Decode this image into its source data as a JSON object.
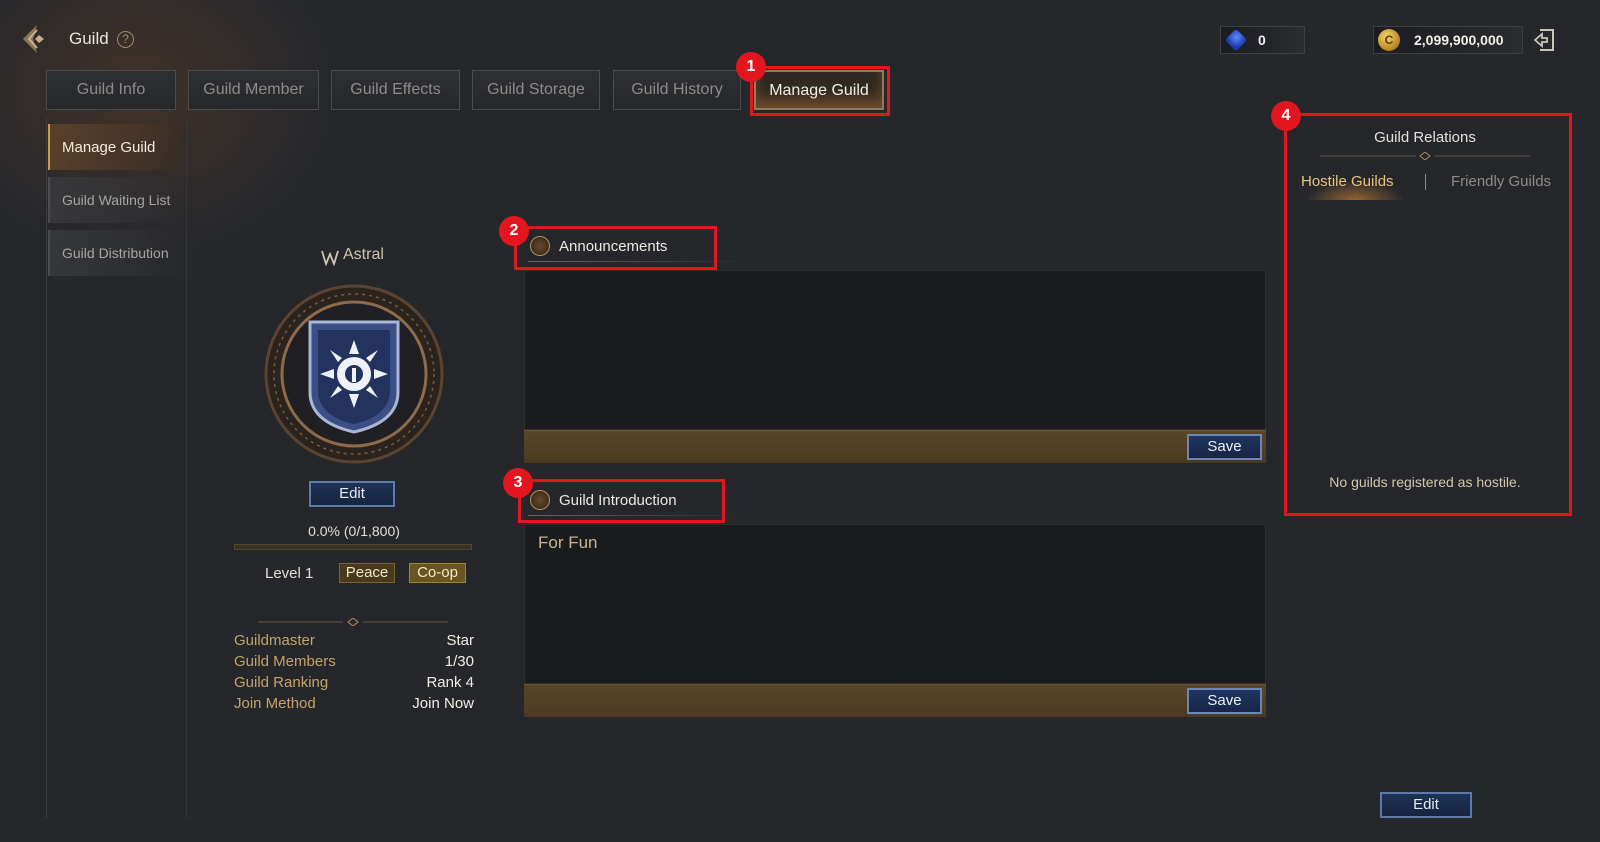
{
  "header": {
    "title": "Guild",
    "help_glyph": "?",
    "gems": "0",
    "gold": "2,099,900,000",
    "gold_glyph": "C"
  },
  "tabs": [
    {
      "label": "Guild Info",
      "active": false
    },
    {
      "label": "Guild Member",
      "active": false
    },
    {
      "label": "Guild Effects",
      "active": false
    },
    {
      "label": "Guild Storage",
      "active": false
    },
    {
      "label": "Guild History",
      "active": false
    },
    {
      "label": "Manage Guild",
      "active": true
    }
  ],
  "sidebar": {
    "items": [
      {
        "label": "Manage Guild",
        "active": true
      },
      {
        "label": "Guild Waiting List",
        "active": false
      },
      {
        "label": "Guild Distribution",
        "active": false
      }
    ]
  },
  "guild": {
    "name": "Astral",
    "edit_label": "Edit",
    "progress_text": "0.0% (0/1,800)",
    "progress_fraction": 0.0,
    "level": "Level 1",
    "tags": [
      "Peace",
      "Co-op"
    ],
    "info": [
      {
        "key": "Guildmaster",
        "value": "Star"
      },
      {
        "key": "Guild Members",
        "value": "1/30"
      },
      {
        "key": "Guild Ranking",
        "value": "Rank 4"
      },
      {
        "key": "Join Method",
        "value": "Join Now"
      }
    ]
  },
  "announcements": {
    "title": "Announcements",
    "text": "",
    "save_label": "Save"
  },
  "introduction": {
    "title": "Guild Introduction",
    "text": "For Fun",
    "save_label": "Save"
  },
  "relations": {
    "title": "Guild Relations",
    "tabs": [
      "Hostile Guilds",
      "Friendly Guilds"
    ],
    "separator": "|",
    "empty_message": "No guilds registered as hostile.",
    "edit_label": "Edit"
  },
  "annotations": [
    "1",
    "2",
    "3",
    "4"
  ],
  "colors": {
    "background": "#25272b",
    "annotation_red": "#e3161f",
    "gold_accent": "#c4a468",
    "button_blue": "#1f3560"
  },
  "icons": [
    "back-arrow-icon",
    "help-icon",
    "sapphire-icon",
    "gold-coin-icon",
    "exit-icon",
    "guild-emblem-icon",
    "section-emblem-icon"
  ]
}
